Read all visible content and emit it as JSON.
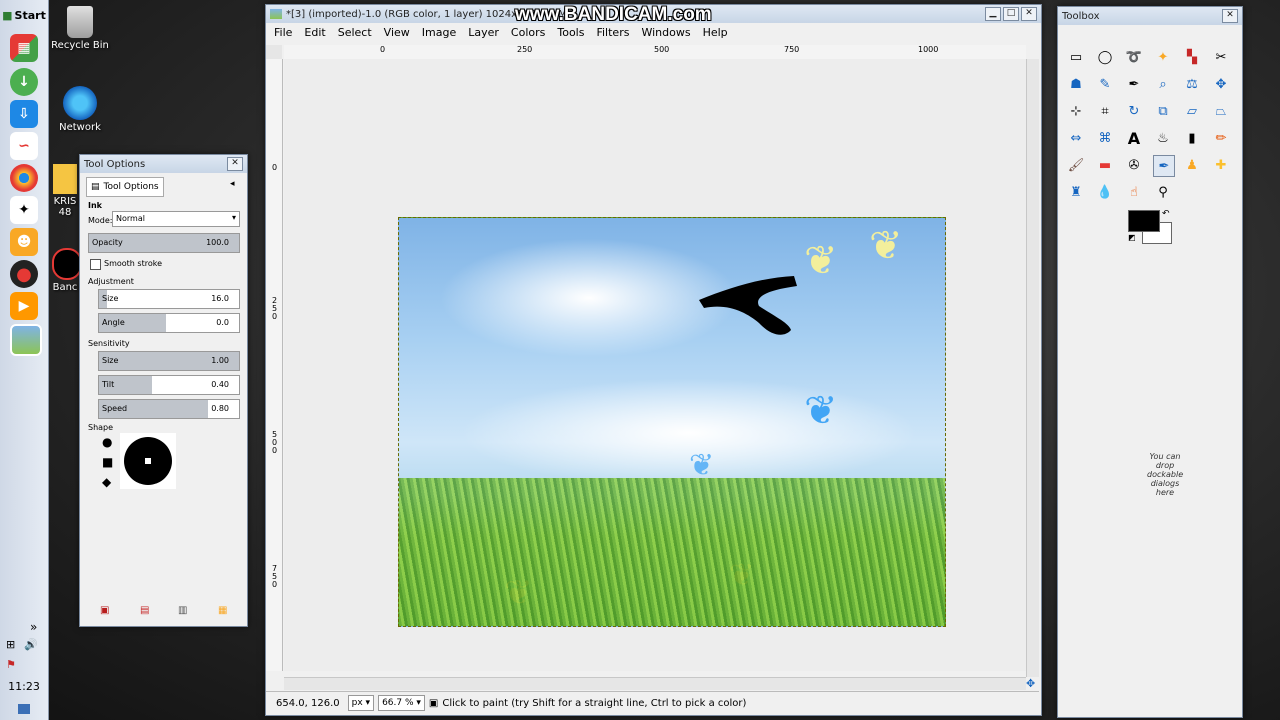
{
  "taskbar": {
    "start": "Start",
    "clock": "11:23",
    "expand": "»"
  },
  "desktop_icons": [
    {
      "name": "recycle-bin",
      "label": "Recycle Bin"
    },
    {
      "name": "network",
      "label": "Network"
    },
    {
      "name": "folder",
      "label": "KRIS 48"
    },
    {
      "name": "bandicam",
      "label": "Banc"
    }
  ],
  "watermark": "www.BANDICAM.com",
  "gimp": {
    "title": "*[3] (imported)-1.0 (RGB color, 1 layer) 1024x768 – GIMP",
    "menu": [
      "File",
      "Edit",
      "Select",
      "View",
      "Image",
      "Layer",
      "Colors",
      "Tools",
      "Filters",
      "Windows",
      "Help"
    ],
    "ruler_h_ticks": [
      "0",
      "250",
      "500",
      "750",
      "1000"
    ],
    "ruler_v_ticks": [
      "0",
      "250",
      "500",
      "750"
    ],
    "status": {
      "coords": "654.0, 126.0",
      "unit": "px",
      "zoom": "66.7 %",
      "message": "Click to paint (try Shift for a straight line, Ctrl to pick a color)"
    }
  },
  "tool_options": {
    "window_title": "Tool Options",
    "tab": "Tool Options",
    "tool": "Ink",
    "mode_label": "Mode:",
    "mode_value": "Normal",
    "opacity_label": "Opacity",
    "opacity_value": "100.0",
    "smooth_label": "Smooth stroke",
    "adjustment_label": "Adjustment",
    "size_label": "Size",
    "size_value": "16.0",
    "angle_label": "Angle",
    "angle_value": "0.0",
    "sensitivity_label": "Sensitivity",
    "sens_size_label": "Size",
    "sens_size_value": "1.00",
    "tilt_label": "Tilt",
    "tilt_value": "0.40",
    "speed_label": "Speed",
    "speed_value": "0.80",
    "shape_label": "Shape"
  },
  "toolbox": {
    "title": "Toolbox",
    "drop_text": "You can drop dockable dialogs here"
  }
}
